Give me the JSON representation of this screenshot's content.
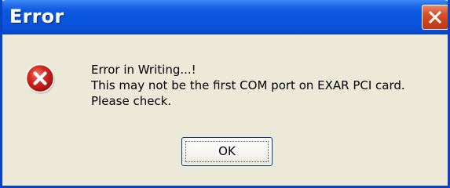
{
  "dialog": {
    "title": "Error",
    "icon": "error-icon",
    "message_lines": [
      "Error in Writing...!",
      "This may not be the first COM port on EXAR PCI card.",
      "Please check."
    ],
    "ok_label": "OK",
    "close_icon": "close-icon"
  },
  "colors": {
    "titlebar": "#0954dc",
    "close_button": "#d8532d",
    "dialog_background": "#ece9d8",
    "error_icon": "#d42a1e",
    "border": "#0842c6"
  }
}
